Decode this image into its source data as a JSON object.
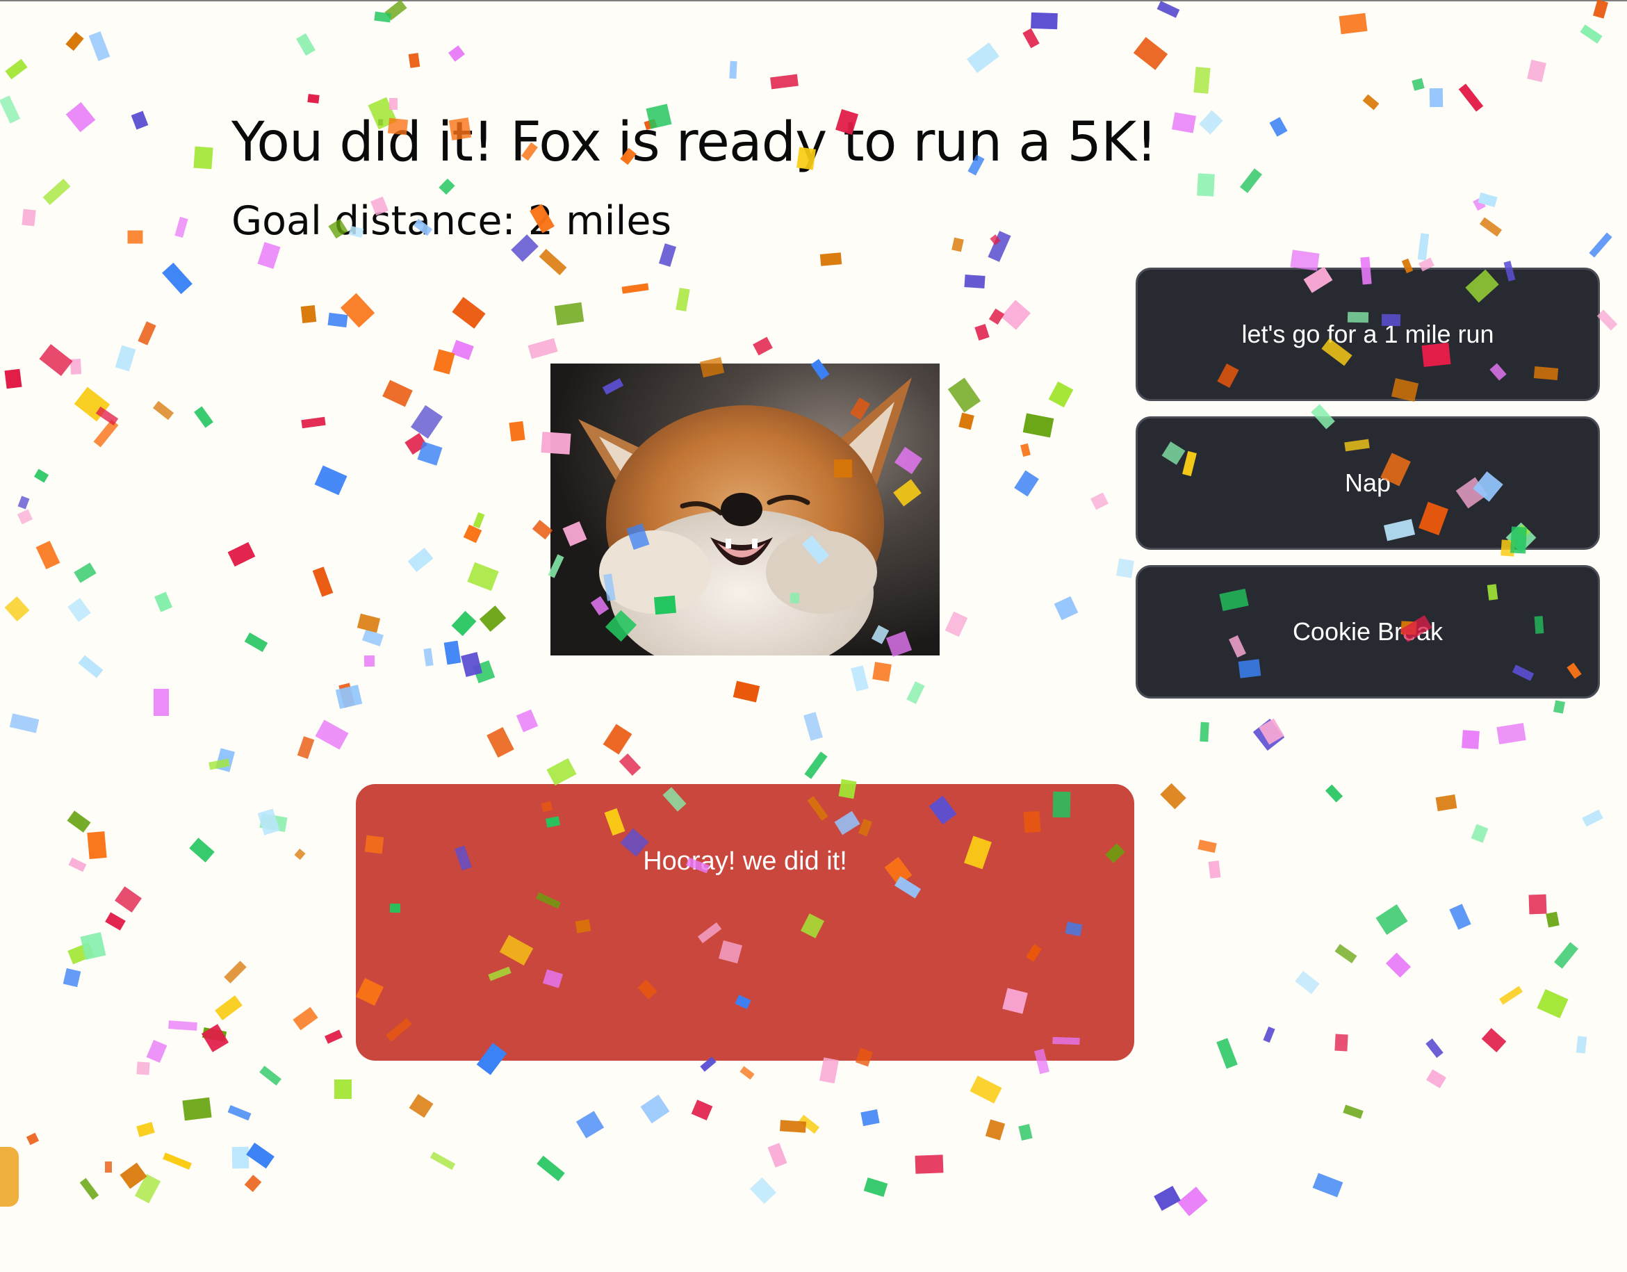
{
  "page": {
    "title": "You did it! Fox is ready to run a 5K!",
    "goal": "Goal distance: 2 miles"
  },
  "actions": [
    {
      "label": "let's go for a 1 mile run"
    },
    {
      "label": "Nap"
    },
    {
      "label": "Cookie Break"
    }
  ],
  "celebrate": {
    "label": "Hooray! we did it!"
  },
  "colors": {
    "background": "#fefdf8",
    "action_button": "#272a31",
    "celebrate_button": "#ca473d",
    "side_tab": "#f0b03e"
  },
  "icons": {
    "photo": "laughing-fox-photo"
  }
}
